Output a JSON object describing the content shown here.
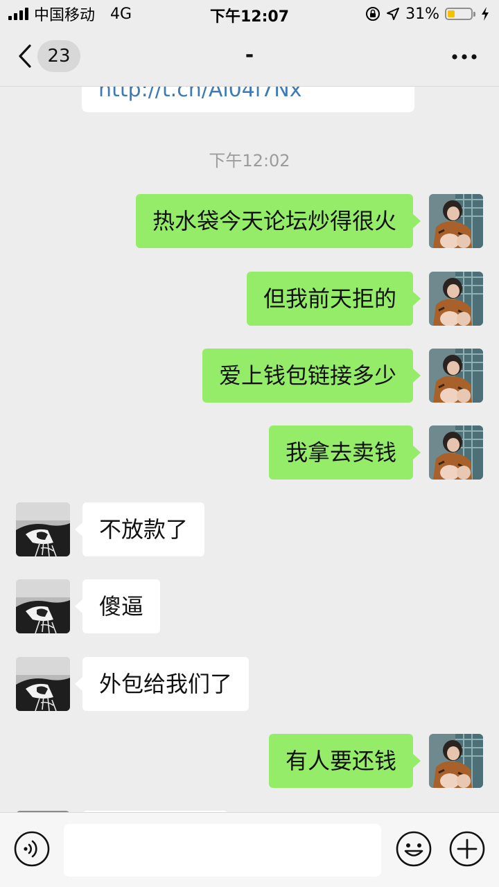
{
  "status_bar": {
    "carrier": "中国移动",
    "network": "4G",
    "time": "下午12:07",
    "battery_percent": "31%",
    "battery_level": 0.31,
    "battery_color": "#f5c000"
  },
  "nav": {
    "unread_count": "23",
    "title": "-"
  },
  "chat": {
    "link_text": "http://t.cn/Ai04i7Nx",
    "timestamp": "下午12:02",
    "messages": [
      {
        "sender": "me",
        "text": "热水袋今天论坛炒得很火"
      },
      {
        "sender": "me",
        "text": "但我前天拒的"
      },
      {
        "sender": "me",
        "text": "爱上钱包链接多少"
      },
      {
        "sender": "me",
        "text": "我拿去卖钱"
      },
      {
        "sender": "other",
        "text": "不放款了"
      },
      {
        "sender": "other",
        "text": "傻逼"
      },
      {
        "sender": "other",
        "text": "外包给我们了"
      },
      {
        "sender": "me",
        "text": "有人要还钱"
      }
    ]
  },
  "input_bar": {
    "voice_icon": "voice-icon",
    "emoji_icon": "emoji-icon",
    "plus_icon": "plus-icon",
    "text_value": ""
  },
  "colors": {
    "my_bubble": "#95ec69",
    "other_bubble": "#ffffff",
    "background": "#ededed",
    "link": "#3d7ab8"
  }
}
